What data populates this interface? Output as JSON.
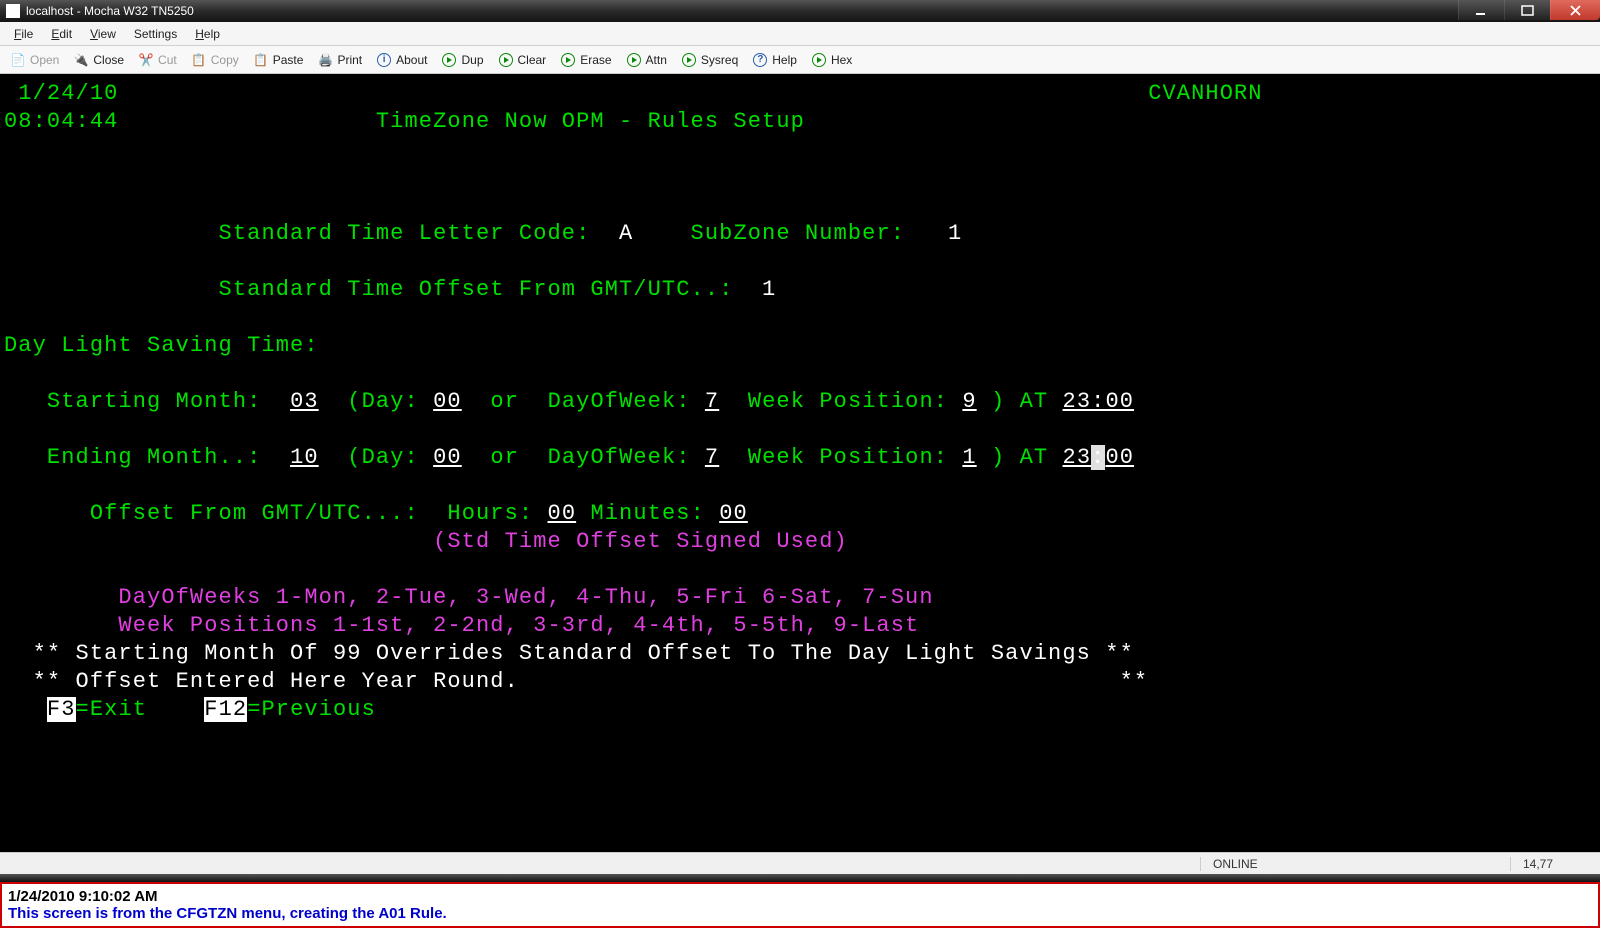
{
  "titlebar": {
    "title": "localhost - Mocha W32 TN5250"
  },
  "menubar": {
    "file": "File",
    "edit": "Edit",
    "view": "View",
    "settings": "Settings",
    "help": "Help"
  },
  "toolbar": {
    "open": "Open",
    "close": "Close",
    "cut": "Cut",
    "copy": "Copy",
    "paste": "Paste",
    "print": "Print",
    "about": "About",
    "dup": "Dup",
    "clear": "Clear",
    "erase": "Erase",
    "attn": "Attn",
    "sysreq": "Sysreq",
    "help": "Help",
    "hex": "Hex"
  },
  "term": {
    "date": " 1/24/10",
    "user": "CVANHORN",
    "time": "08:04:44",
    "title": "TimeZone Now OPM - Rules Setup",
    "lbl_stdcode": "Standard Time Letter Code:",
    "val_stdcode": "A",
    "lbl_subzone": "SubZone Number:",
    "val_subzone": "1",
    "lbl_stdoffset": "Standard Time Offset From GMT/UTC..:",
    "val_stdoffset": "1",
    "dst_header": "Day Light Saving Time:",
    "start_lbl": "Starting Month:",
    "start_month": "03",
    "start_day": "00",
    "start_dow": "7",
    "start_wp": "9",
    "start_at": "23:00",
    "end_lbl": "Ending Month..:",
    "end_month": "10",
    "end_day": "00",
    "end_dow": "7",
    "end_wp": "1",
    "end_at_h": "23",
    "end_at_m": "00",
    "day_lbl": "(Day:",
    "or": "or",
    "dow_lbl": "DayOfWeek:",
    "wp_lbl": "Week Position:",
    "rp": ")",
    "at": "AT",
    "offset_lbl": "Offset From GMT/UTC...:",
    "hours_lbl": "Hours:",
    "hours_val": "00",
    "min_lbl": "Minutes:",
    "min_val": "00",
    "note1": "(Std Time Offset Signed Used)",
    "note2": "DayOfWeeks 1-Mon, 2-Tue, 3-Wed, 4-Thu, 5-Fri 6-Sat, 7-Sun",
    "note3": "Week Positions 1-1st, 2-2nd, 3-3rd, 4-4th, 5-5th, 9-Last",
    "over1": "** Starting Month Of 99 Overrides Standard Offset To The Day Light Savings **",
    "over2": "** Offset Entered Here Year Round.                                          **",
    "f3": "F3",
    "f3lbl": "=Exit",
    "f12": "F12",
    "f12lbl": "=Previous"
  },
  "status": {
    "online": "ONLINE",
    "pos": "14,77"
  },
  "annotation": {
    "ts": "1/24/2010 9:10:02 AM",
    "body": "This screen is from the CFGTZN menu, creating the A01 Rule."
  }
}
